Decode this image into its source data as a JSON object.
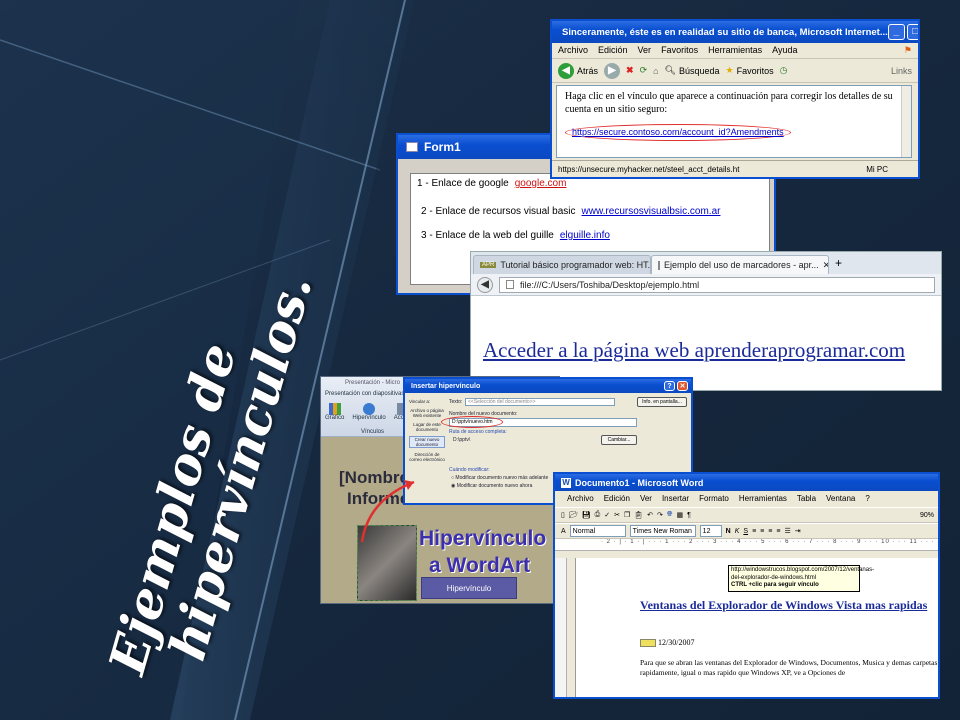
{
  "slide": {
    "title_line1": "Ejemplos de",
    "title_line2": "hipervínculos."
  },
  "ie_window": {
    "title": "Sinceramente, éste es en realidad su sitio de banca, Microsoft Internet...",
    "menu": [
      "Archivo",
      "Edición",
      "Ver",
      "Favoritos",
      "Herramientas",
      "Ayuda"
    ],
    "back_label": "Atrás",
    "search_label": "Búsqueda",
    "favorites_label": "Favoritos",
    "links_label": "Links",
    "body_text": "Haga clic en el vínculo que aparece a continuación para corregir los detalles de su cuenta en un sitio seguro:",
    "secure_link": "https://secure.contoso.com/account_id?Amendments",
    "status_url": "https://unsecure.myhacker.net/steel_acct_details.ht",
    "zone": "Mi PC"
  },
  "form1": {
    "title": "Form1",
    "rows": [
      {
        "label": "1 - Enlace de google",
        "link": "google.com"
      },
      {
        "label": "2 - Enlace de recursos visual basic",
        "link": "www.recursosvisualbsic.com.ar"
      },
      {
        "label": "3 - Enlace de la web del guille",
        "link": "elguille.info"
      }
    ]
  },
  "firefox": {
    "tab1": "Tutorial básico programador web: HT...",
    "tab2": "Ejemplo del uso de marcadores - apr...",
    "url": "file:///C:/Users/Toshiba/Desktop/ejemplo.html",
    "page_link": "Acceder a la página web aprenderaprogramar.com"
  },
  "powerpoint": {
    "title": "Presentación - Micro",
    "ribbon_label": "Presentación con diapositivas",
    "ribbon_items": [
      "Gráfico",
      "Hipervínculo",
      "Acción"
    ],
    "group_label": "Vínculos",
    "nombre": "[Nombre",
    "informe": "Informe",
    "wordart_line1": "Hipervínculo",
    "wordart_line2": "a WordArt",
    "hyper_button": "Hipervínculo"
  },
  "insert_dialog": {
    "title": "Insertar hipervínculo",
    "link_to": "Vincular a:",
    "side_options": [
      "Archivo o página Web existente",
      "Lugar de este documento",
      "Crear nuevo documento",
      "Dirección de correo electrónico"
    ],
    "text_label": "Texto:",
    "text_value": "<<Selección del documento>>",
    "screen_tip": "Info. en pantalla...",
    "new_doc_label": "Nombre del nuevo documento:",
    "new_doc_value": "D:\\pptv\\nuevo.htm",
    "full_path_label": "Ruta de acceso completa:",
    "full_path_value": "D:\\pptv\\",
    "change_button": "Cambiar...",
    "when_edit": "Cuándo modificar:",
    "edit_later": "Modificar documento nuevo más adelante",
    "edit_now": "Modificar documento nuevo ahora"
  },
  "word": {
    "title": "Documento1 - Microsoft Word",
    "menu": [
      "Archivo",
      "Edición",
      "Ver",
      "Insertar",
      "Formato",
      "Herramientas",
      "Tabla",
      "Ventana",
      "?"
    ],
    "style": "Normal",
    "font": "Times New Roman",
    "size": "12",
    "zoom": "90%",
    "ruler": "· 2 · | · 1 · | · · · 1 · · · 2 · · · 3 · · · 4 · · · 5 · · · 6 · · · 7 · · · 8 · · · 9 · · · 10 · · · 11 · · · 12 · · · 13 · · · 14 ·",
    "tooltip_url": "http://windowstrucos.blogspot.com/2007/12/ventanas-del-explorador-de-windows.html",
    "tooltip_hint": "CTRL +clic para seguir vínculo",
    "heading": "Ventanas del Explorador de Windows Vista mas rapidas",
    "date": "12/30/2007",
    "body": "Para que se abran las ventanas del Explorador de Windows, Documentos, Musica y demas carpetas rapidamente, igual o mas rapido que Windows XP, ve a Opciones de"
  }
}
